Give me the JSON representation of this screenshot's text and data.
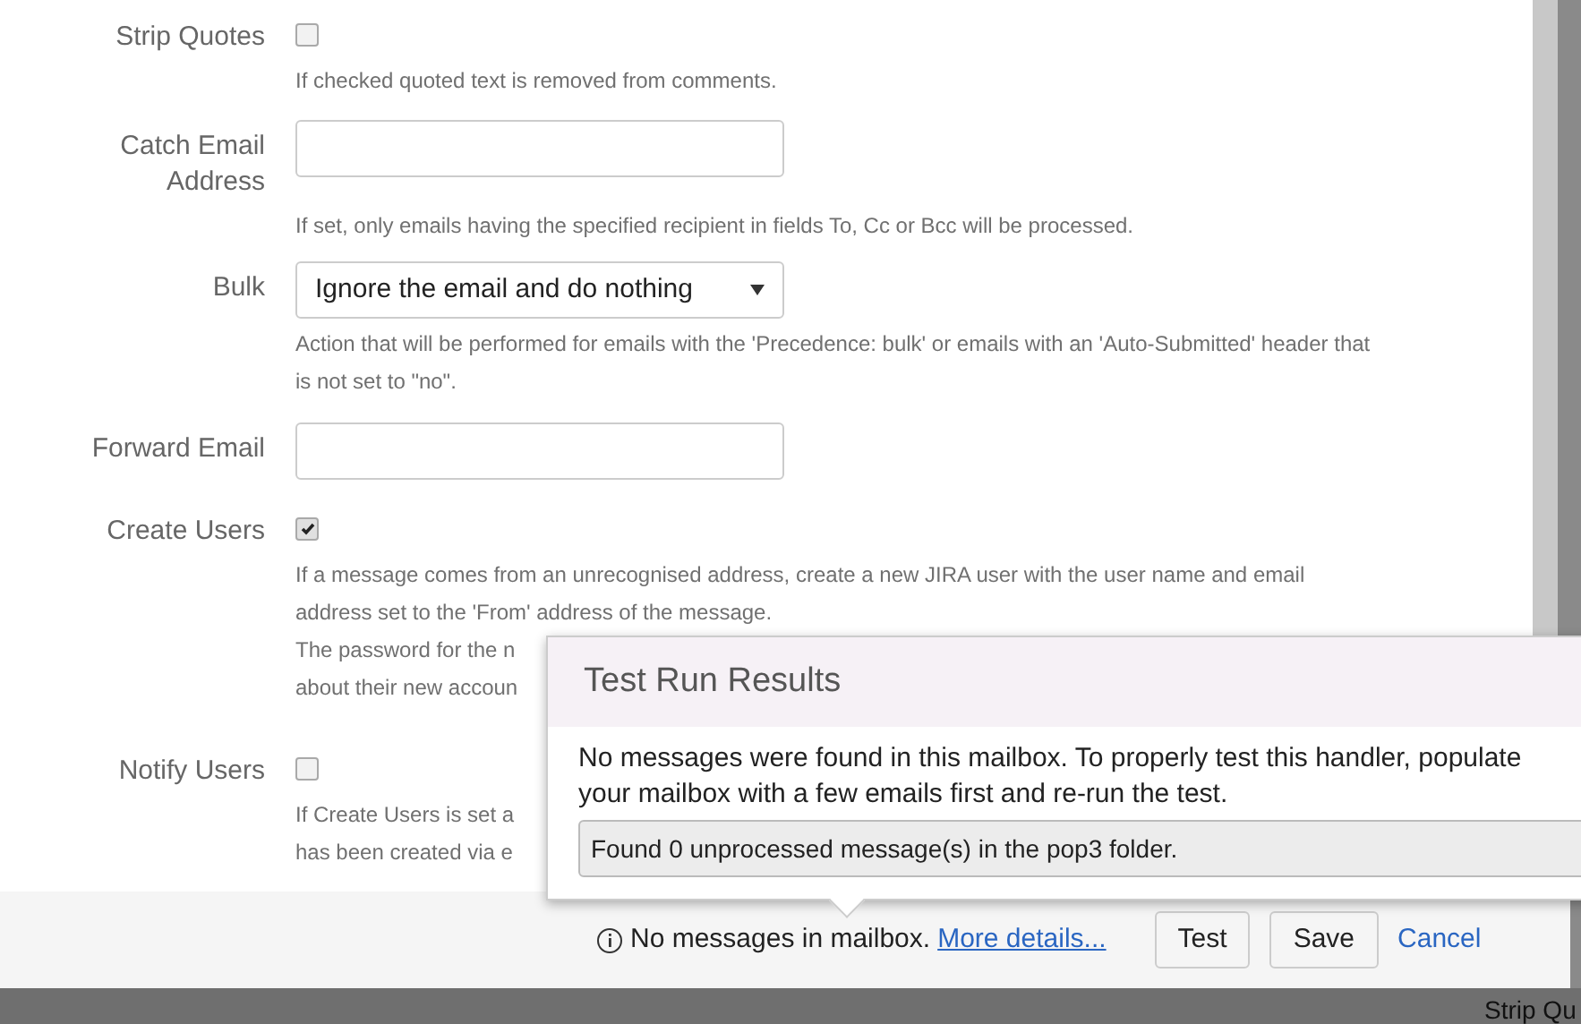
{
  "fields": [
    {
      "kind": "checkbox",
      "label_lines": [
        "Strip Quotes"
      ],
      "checked": false,
      "help": [
        "If checked quoted text is removed from comments."
      ]
    },
    {
      "kind": "text",
      "label_lines": [
        "Catch Email",
        "Address"
      ],
      "help": [
        "If set, only emails having the specified recipient in fields To, Cc or Bcc will be processed."
      ]
    },
    {
      "kind": "select",
      "label_lines": [
        "Bulk"
      ],
      "value": "Ignore the email and do nothing",
      "help": [
        "Action that will be performed for emails with the 'Precedence: bulk' or emails with an 'Auto-Submitted' header that",
        "is not set to \"no\"."
      ]
    },
    {
      "kind": "text",
      "label_lines": [
        "Forward Email"
      ]
    },
    {
      "kind": "checkbox",
      "label_lines": [
        "Create Users"
      ],
      "checked": true,
      "help": [
        "If a message comes from an unrecognised address, create a new JIRA user with the user name and email",
        "address set to the 'From' address of the message.",
        "The password for the n",
        "about their new accoun"
      ]
    },
    {
      "kind": "checkbox",
      "label_lines": [
        "Notify Users"
      ],
      "checked": false,
      "help": [
        "If Create Users is set a",
        "has been created via e"
      ]
    }
  ],
  "footer": {
    "status": "No messages in mailbox.",
    "link": "More details...",
    "buttons": [
      "Test",
      "Save"
    ],
    "cancel": "Cancel"
  },
  "popup": {
    "title": "Test Run Results",
    "message": "No messages were found in this mailbox. To properly test this handler, populate your mailbox with a few emails first and re-run the test.",
    "result": "Found 0 unprocessed message(s) in the pop3 folder."
  },
  "background": {
    "text": "Strip Qu"
  }
}
